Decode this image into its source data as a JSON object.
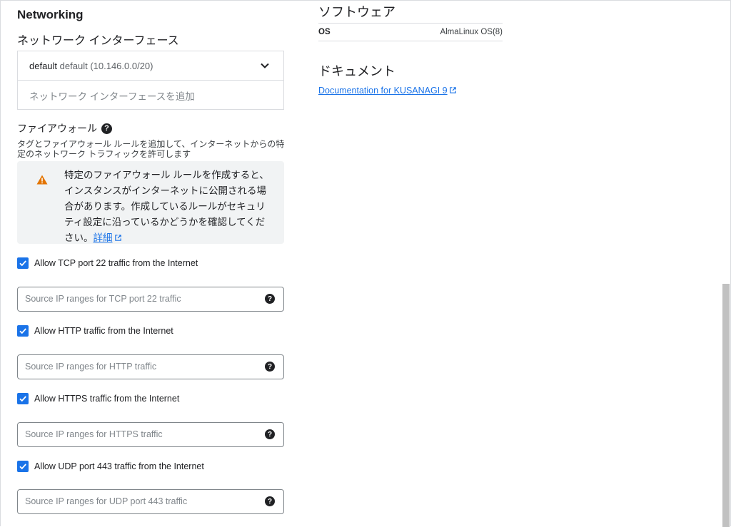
{
  "networking": {
    "title": "Networking",
    "interfaces_title": "ネットワーク インターフェース",
    "interface": {
      "name": "default",
      "detail": "default (10.146.0.0/20)"
    },
    "add_interface": "ネットワーク インターフェースを追加"
  },
  "firewall": {
    "title": "ファイアウォール",
    "help_glyph": "?",
    "description": "タグとファイアウォール ルールを追加して、インターネットからの特定のネットワーク トラフィックを許可します",
    "warning_text": "特定のファイアウォール ルールを作成すると、インスタンスがインターネットに公開される場合があります。作成しているルールがセキュリティ設定に沿っているかどうかを確認してください。",
    "warning_link": "詳細",
    "rules": [
      {
        "label": "Allow TCP port 22 traffic from the Internet",
        "placeholder": "Source IP ranges for TCP port 22 traffic"
      },
      {
        "label": "Allow HTTP traffic from the Internet",
        "placeholder": "Source IP ranges for HTTP traffic"
      },
      {
        "label": "Allow HTTPS traffic from the Internet",
        "placeholder": "Source IP ranges for HTTPS traffic"
      },
      {
        "label": "Allow UDP port 443 traffic from the Internet",
        "placeholder": "Source IP ranges for UDP port 443 traffic"
      }
    ]
  },
  "software": {
    "title": "ソフトウェア",
    "os_key": "OS",
    "os_value": "AlmaLinux OS(8)"
  },
  "documents": {
    "title": "ドキュメント",
    "link": "Documentation for KUSANAGI 9"
  },
  "colors": {
    "accent": "#1a73e8",
    "warning": "#e37400",
    "panel": "#f1f3f4"
  },
  "icons": [
    "chevron-down-icon",
    "help-icon",
    "warning-icon",
    "external-link-icon",
    "checkbox-checked-icon"
  ]
}
